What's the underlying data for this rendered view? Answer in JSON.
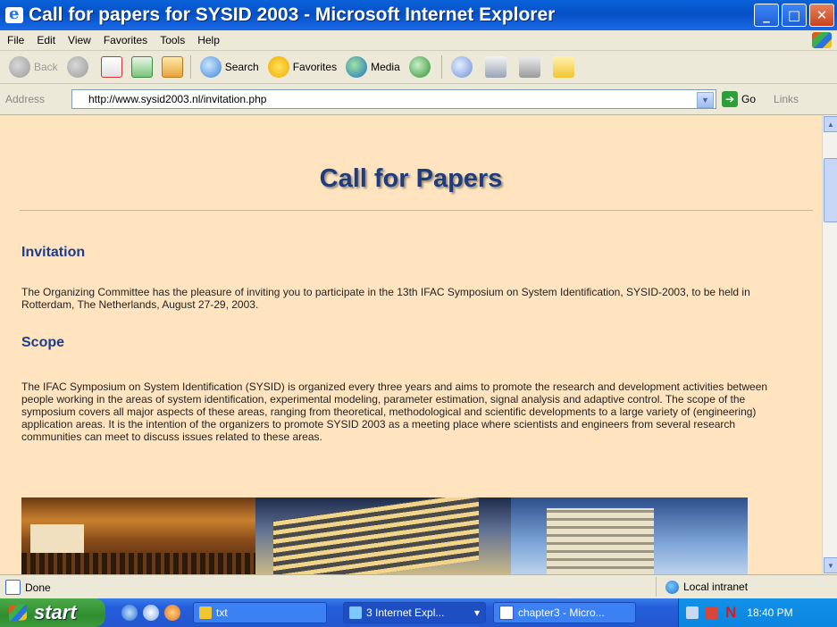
{
  "window": {
    "title": "Call for papers for SYSID 2003 - Microsoft Internet Explorer",
    "controls": [
      "_",
      "□",
      "✕"
    ]
  },
  "menu": [
    "File",
    "Edit",
    "View",
    "Favorites",
    "Tools",
    "Help"
  ],
  "toolbar": {
    "back": "Back",
    "search": "Search",
    "favorites": "Favorites",
    "media": "Media"
  },
  "address": {
    "label": "Address",
    "url": "http://www.sysid2003.nl/invitation.php",
    "go": "Go",
    "links": "Links"
  },
  "page": {
    "title": "Call for Papers",
    "sections": [
      {
        "heading": "Invitation",
        "text": "The Organizing Committee has the pleasure of inviting you to participate in the 13th IFAC Symposium on System Identification, SYSID-2003, to be held in Rotterdam, The Netherlands, August 27-29, 2003."
      },
      {
        "heading": "Scope",
        "text": "The IFAC Symposium on System Identification (SYSID) is organized every three years and aims to promote the research and development activities between people working in the areas of system identification, experimental modeling, parameter estimation, signal analysis and adaptive control. The scope of the symposium covers all major aspects of these areas, ranging from theoretical, methodological and scientific developments to a large variety of (engineering) application areas. It is the intention of the organizers to promote SYSID 2003 as a meeting place where scientists and engineers from several research communities can meet to discuss issues related to these areas."
      }
    ]
  },
  "status": {
    "text": "Done",
    "zone": "Local intranet"
  },
  "taskbar": {
    "start": "start",
    "tasks": [
      {
        "label": "txt"
      },
      {
        "label": "3 Internet Expl...",
        "arrow": "▾"
      },
      {
        "label": "chapter3 - Micro..."
      }
    ],
    "tray_letter": "N",
    "clock": "18:40 PM"
  },
  "colors": {
    "accent": "#203c7c",
    "page_bg": "#ffe4bf",
    "heading": "#1d3d8a"
  }
}
